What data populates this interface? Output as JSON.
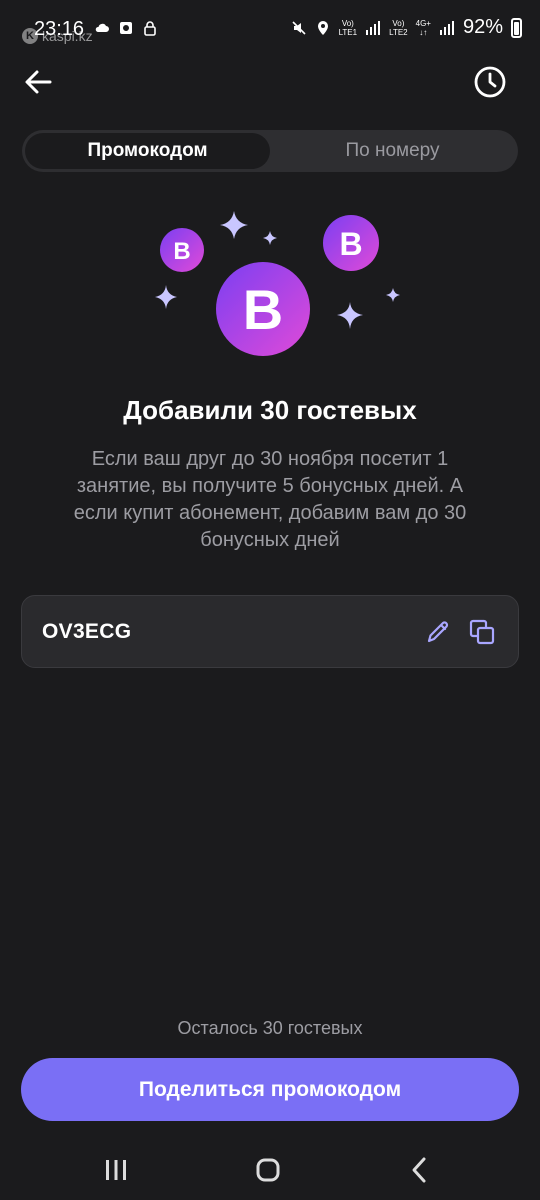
{
  "status_bar": {
    "time": "23:16",
    "watermark": "kaspi.kz",
    "battery": "92%",
    "sim1": "LTE1",
    "sim2": "LTE2",
    "network": "4G+",
    "volte": "Vo)"
  },
  "header": {
    "back_icon": "arrow-left-icon",
    "history_icon": "clock-history-icon"
  },
  "tabs": [
    {
      "label": "Промокодом",
      "active": true
    },
    {
      "label": "По номеру",
      "active": false
    }
  ],
  "illustration": {
    "badge_letter": "B"
  },
  "title": "Добавили 30 гостевых",
  "description": "Если ваш друг до 30 ноября посетит 1 занятие, вы получите 5 бонусных дней. А если купит абонемент, добавим вам до 30 бонусных дней",
  "promo": {
    "code": "OV3ECG",
    "edit_icon": "pencil-icon",
    "copy_icon": "copy-icon"
  },
  "remaining_text": "Осталось 30 гостевых",
  "share_button": "Поделиться промокодом",
  "nav": {
    "recent_icon": "recent-apps-icon",
    "home_icon": "home-icon",
    "back_icon": "back-chevron-icon"
  },
  "colors": {
    "accent": "#7a6ff5",
    "background": "#1b1b1d",
    "badge_gradient_start": "#7b3ff2",
    "badge_gradient_end": "#e04ad8",
    "sparkle": "#c9c6ff"
  }
}
